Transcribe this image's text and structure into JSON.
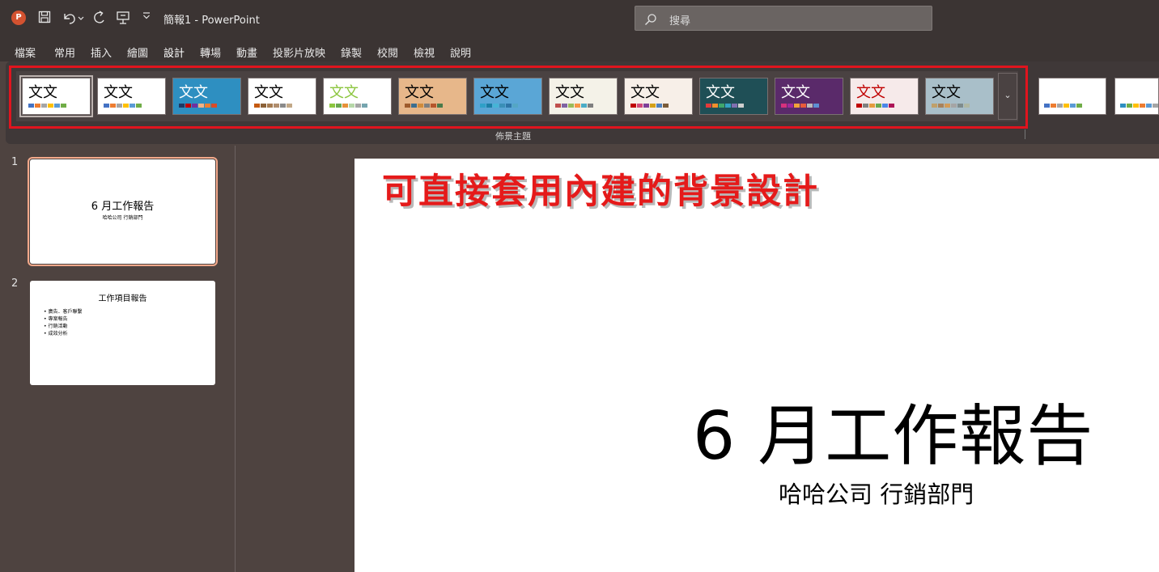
{
  "app": {
    "icon_letter": "P",
    "title": "簡報1 - PowerPoint"
  },
  "search": {
    "placeholder": "搜尋"
  },
  "menu": {
    "tabs": [
      "檔案",
      "常用",
      "插入",
      "繪圖",
      "設計",
      "轉場",
      "動畫",
      "投影片放映",
      "錄製",
      "校閱",
      "檢視",
      "說明"
    ],
    "active": "設計"
  },
  "ribbon": {
    "group_label": "佈景主題",
    "theme_sample_text": "文文",
    "themes": [
      {
        "name": "office-theme",
        "bg": "#ffffff",
        "fg": "#000000",
        "swatches": [
          "#4472c4",
          "#ed7d31",
          "#a5a5a5",
          "#ffc000",
          "#5b9bd5",
          "#70ad47"
        ]
      },
      {
        "name": "office-theme-2",
        "bg": "#ffffff",
        "fg": "#000000",
        "swatches": [
          "#4472c4",
          "#ed7d31",
          "#a5a5a5",
          "#ffc000",
          "#5b9bd5",
          "#70ad47"
        ]
      },
      {
        "name": "facet-blue",
        "bg": "#2e8fc1",
        "fg": "#ffffff",
        "swatches": [
          "#1f3864",
          "#c00000",
          "#7030a0",
          "#f4b183",
          "#ed7d31",
          "#d94b26"
        ]
      },
      {
        "name": "integral",
        "bg": "#ffffff",
        "fg": "#000000",
        "swatches": [
          "#c55a11",
          "#8c6239",
          "#a57c52",
          "#b08e6e",
          "#8a8a8a",
          "#c2a887"
        ]
      },
      {
        "name": "facet-green",
        "bg": "#ffffff",
        "fg": "#8cc63f",
        "swatches": [
          "#8cc63f",
          "#6aa84f",
          "#e69138",
          "#b6d7a8",
          "#a6a6a6",
          "#76a5af"
        ]
      },
      {
        "name": "wood-type",
        "bg": "#e7b78a",
        "fg": "#000000",
        "swatches": [
          "#9e5b2c",
          "#3c6e8f",
          "#d08b3b",
          "#7f7f7f",
          "#b5562c",
          "#4a7a4a"
        ]
      },
      {
        "name": "wisp-pattern",
        "bg": "#5aa6d6",
        "fg": "#000000",
        "swatches": [
          "#2fa0c8",
          "#1b7fa6",
          "#46b4d6",
          "#3a8fb7",
          "#2e75a6",
          "#54a6c4"
        ]
      },
      {
        "name": "retrospect",
        "bg": "#f4f2e8",
        "fg": "#000000",
        "swatches": [
          "#c0504d",
          "#8064a2",
          "#9bbb59",
          "#f79646",
          "#4bacc6",
          "#7f7f7f"
        ]
      },
      {
        "name": "savon",
        "bg": "#f7efe8",
        "fg": "#000000",
        "swatches": [
          "#c00000",
          "#d1497a",
          "#7f3f98",
          "#d4a017",
          "#4f81bd",
          "#7a5c3a"
        ]
      },
      {
        "name": "ion-dark",
        "bg": "#1f4f56",
        "fg": "#ffffff",
        "swatches": [
          "#e23a3a",
          "#f18f2c",
          "#3fa66b",
          "#34a1c3",
          "#7f6fb0",
          "#cfcfcf"
        ]
      },
      {
        "name": "ion-purple",
        "bg": "#5a2a6a",
        "fg": "#ffffff",
        "swatches": [
          "#d6317d",
          "#a0289c",
          "#f2a23a",
          "#e85b3a",
          "#b9b9b9",
          "#5d8fd3"
        ]
      },
      {
        "name": "berlin-red",
        "bg": "#f6eaea",
        "fg": "#c00000",
        "swatches": [
          "#c00000",
          "#7f7f7f",
          "#e49b3d",
          "#6aa84f",
          "#4a86e8",
          "#ad1457"
        ]
      },
      {
        "name": "gallery-gray",
        "bg": "#a9bfc9",
        "fg": "#000000",
        "swatches": [
          "#c0a06b",
          "#a9825b",
          "#d29b58",
          "#a5a5a5",
          "#7f8c8d",
          "#b0b7a3"
        ]
      }
    ],
    "variants": [
      {
        "name": "variant-1",
        "swatches": [
          "#4472c4",
          "#ed7d31",
          "#a5a5a5",
          "#ffc000",
          "#5b9bd5",
          "#70ad47"
        ]
      },
      {
        "name": "variant-2",
        "swatches": [
          "#2e8fc1",
          "#70ad47",
          "#ffc000",
          "#ed7d31",
          "#5b9bd5",
          "#a5a5a5"
        ]
      }
    ],
    "more_glyph": "⌄"
  },
  "slides_pane": {
    "slides": [
      {
        "number": "1",
        "title": "6 月工作報告",
        "subtitle": "哈哈公司 行銷部門"
      },
      {
        "number": "2",
        "title": "工作項目報告",
        "bullets": [
          "• 廣告．客戶聯繫",
          "• 專案報告",
          "• 行銷活動",
          "• 成效分析"
        ]
      }
    ]
  },
  "annotation": {
    "text": "可直接套用內建的背景設計",
    "color": "#e51a1a"
  },
  "main_slide": {
    "title": "6 月工作報告",
    "subtitle": "哈哈公司 行銷部門"
  }
}
